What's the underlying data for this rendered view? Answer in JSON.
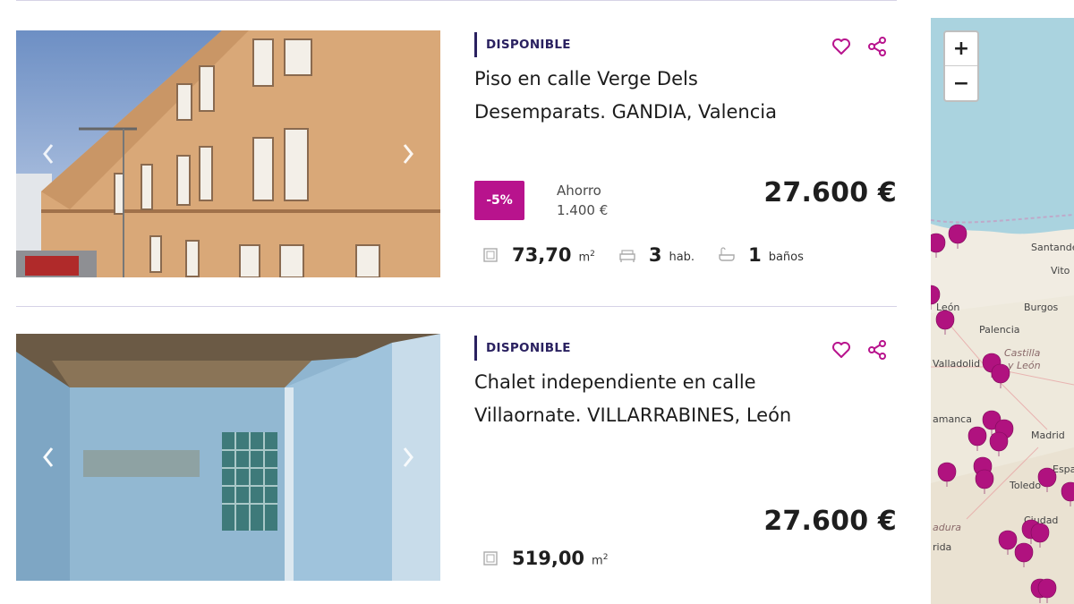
{
  "listings": [
    {
      "status": "DISPONIBLE",
      "title_line1": "Piso en calle Verge Dels",
      "title_line2": "Desemparats. GANDIA, Valencia",
      "discount": "-5%",
      "savings_label": "Ahorro",
      "savings_value": "1.400 €",
      "price": "27.600 €",
      "area_value": "73,70",
      "area_unit": "m",
      "area_unit_sup": "2",
      "rooms_value": "3",
      "rooms_unit": "hab.",
      "baths_value": "1",
      "baths_unit": "baños"
    },
    {
      "status": "DISPONIBLE",
      "title_line1": "Chalet independiente en calle",
      "title_line2": "Villaornate. VILLARRABINES, León",
      "price": "27.600 €",
      "area_value": "519,00",
      "area_unit": "m",
      "area_unit_sup": "2"
    }
  ],
  "map": {
    "zoom_in": "+",
    "zoom_out": "−",
    "labels": [
      "Santander",
      "Vito",
      "León",
      "Burgos",
      "Palencia",
      "Castilla",
      "y León",
      "Valladolid",
      "amanca",
      "Madrid",
      "Espa",
      "Toledo",
      "Ciudad",
      "adura",
      "rida"
    ]
  },
  "colors": {
    "accent": "#b8138d",
    "status_bar": "#2a2160",
    "pin": "#b0127f"
  }
}
